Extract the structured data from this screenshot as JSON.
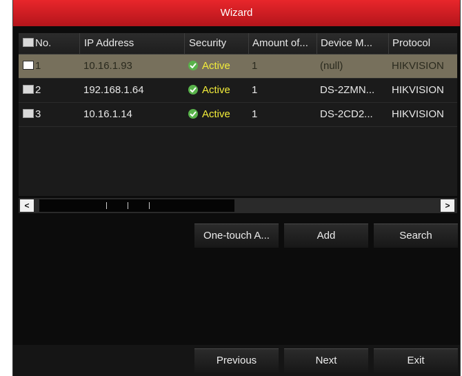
{
  "window": {
    "title": "Wizard"
  },
  "table": {
    "columns": [
      "No.",
      "IP Address",
      "Security",
      "Amount of...",
      "Device M...",
      "Protocol"
    ],
    "rows": [
      {
        "no": "1",
        "ip": "10.16.1.93",
        "security": "Active",
        "amount": "1",
        "device": "(null)",
        "protocol": "HIKVISION",
        "selected": true
      },
      {
        "no": "2",
        "ip": "192.168.1.64",
        "security": "Active",
        "amount": "1",
        "device": "DS-2ZMN...",
        "protocol": "HIKVISION",
        "selected": false
      },
      {
        "no": "3",
        "ip": "10.16.1.14",
        "security": "Active",
        "amount": "1",
        "device": "DS-2CD2...",
        "protocol": "HIKVISION",
        "selected": false
      }
    ]
  },
  "scrollbar": {
    "left_arrow": "<",
    "right_arrow": ">"
  },
  "actions": {
    "one_touch": "One-touch A...",
    "add": "Add",
    "search": "Search"
  },
  "nav": {
    "previous": "Previous",
    "next": "Next",
    "exit": "Exit"
  },
  "colors": {
    "title_bar": "#d21d23",
    "selected_row": "#77705c",
    "active_text": "#f3ed3a",
    "check_icon": "#58b24a"
  }
}
